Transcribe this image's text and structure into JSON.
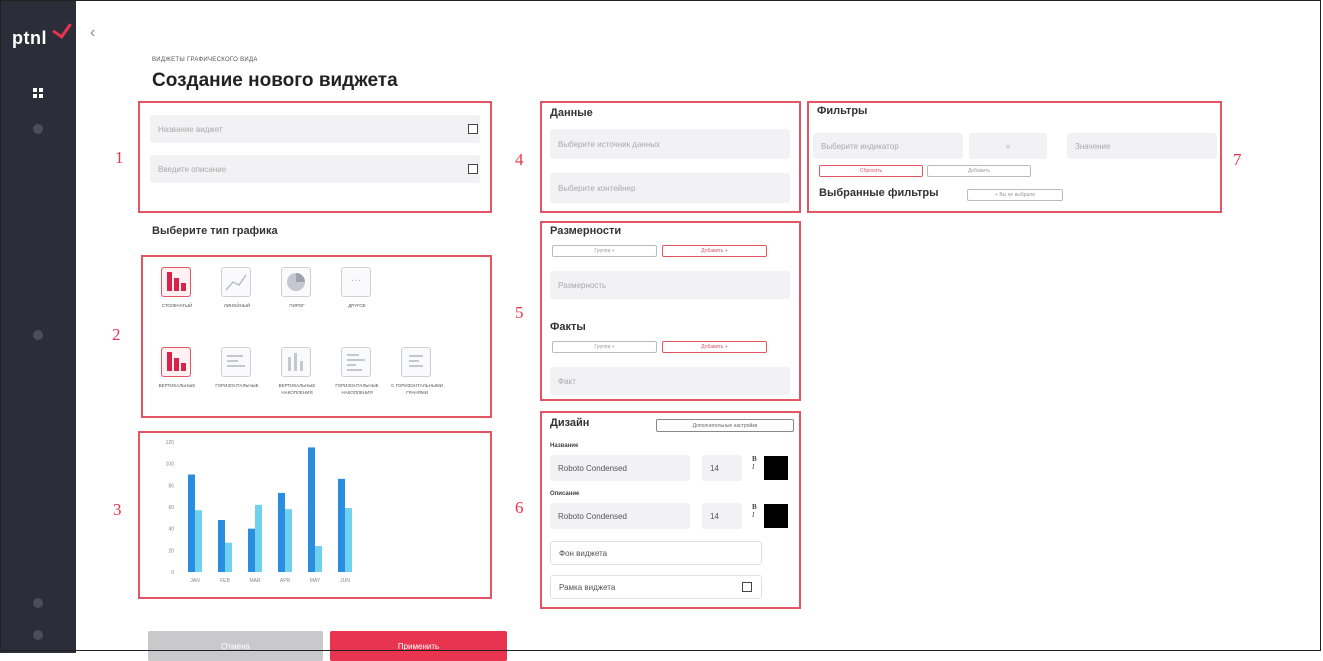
{
  "app": {
    "logo_text": "ptnl"
  },
  "breadcrumb": "ВИДЖЕТЫ ГРАФИЧЕСКОГО ВИДА",
  "page_title": "Создание нового виджета",
  "widget_info": {
    "name_placeholder": "Название виджет",
    "desc_placeholder": "Введите описание"
  },
  "chart_types": {
    "title": "Выберите тип графика",
    "row1": [
      {
        "label": "СТОЛБЧАТЫЙ",
        "icon": "bar-chart-icon",
        "selected": true
      },
      {
        "label": "ЛИНЕЙНЫЙ",
        "icon": "line-chart-icon",
        "selected": false
      },
      {
        "label": "ПИРОГ",
        "icon": "pie-chart-icon",
        "selected": false
      },
      {
        "label": "ДРУГОЕ",
        "icon": "more-icon",
        "selected": false
      }
    ],
    "row2": [
      {
        "label": "ВЕРТИКАЛЬНЫЕ",
        "icon": "vertical-bar-icon",
        "selected": true
      },
      {
        "label": "ГОРИЗОНТАЛЬНЫЕ",
        "icon": "horizontal-bar-icon",
        "selected": false
      },
      {
        "label": "ВЕРТИКАЛЬНЫЕ НАКОПЛЕНИЯ",
        "icon": "stacked-vertical-icon",
        "selected": false
      },
      {
        "label": "ГОРИЗОНТАЛЬНЫЕ НАКОПЛЕНИЯ",
        "icon": "stacked-horizontal-icon",
        "selected": false
      },
      {
        "label": "С ГОРИЗОНТАЛЬНЫМИ ГРАНЯМИ",
        "icon": "horizontal-edge-icon",
        "selected": false
      }
    ]
  },
  "chart_data": {
    "type": "bar",
    "categories": [
      "JAN",
      "FEB",
      "MAR",
      "APR",
      "MAY",
      "JUN"
    ],
    "series": [
      {
        "values": [
          90,
          48,
          40,
          73,
          115,
          86
        ]
      },
      {
        "values": [
          57,
          27,
          62,
          58,
          24,
          59
        ]
      }
    ],
    "y_ticks": [
      "120",
      "100",
      "80",
      "60",
      "40",
      "20",
      "0"
    ],
    "ylim": [
      0,
      120
    ],
    "colors": [
      "#2a8ee0",
      "#6fd0f0"
    ]
  },
  "data_section": {
    "title": "Данные",
    "source_placeholder": "Выберите источник данных",
    "container_placeholder": "Выберите контейнер"
  },
  "filters": {
    "title": "Фильтры",
    "indicator_placeholder": "Выберите индикатор",
    "operator": "=",
    "value_placeholder": "Значение",
    "btn1": "Сбросить",
    "btn2": "Добавить",
    "selected_title": "Выбранные фильтры",
    "selected_btn": "+ Вы не выбрали"
  },
  "dimensions": {
    "title": "Размерности",
    "btn_group": "Группа +",
    "btn_add": "Добавить +",
    "placeholder": "Размерность",
    "facts_title": "Факты",
    "facts_placeholder": "Факт"
  },
  "design": {
    "title": "Дизайн",
    "extra_btn": "Дополнительные настройки",
    "name_label": "Название",
    "name_font": "Roboto Condensed",
    "name_size": "14",
    "desc_label": "Описание",
    "desc_font": "Roboto Condensed",
    "desc_size": "14",
    "bg_label": "Фон виджета",
    "border_label": "Рамка виджета",
    "swatch_color": "#000000"
  },
  "callouts": [
    "1",
    "2",
    "3",
    "4",
    "5",
    "6",
    "7"
  ],
  "footer": {
    "cancel": "Отмена",
    "apply": "Применить"
  }
}
